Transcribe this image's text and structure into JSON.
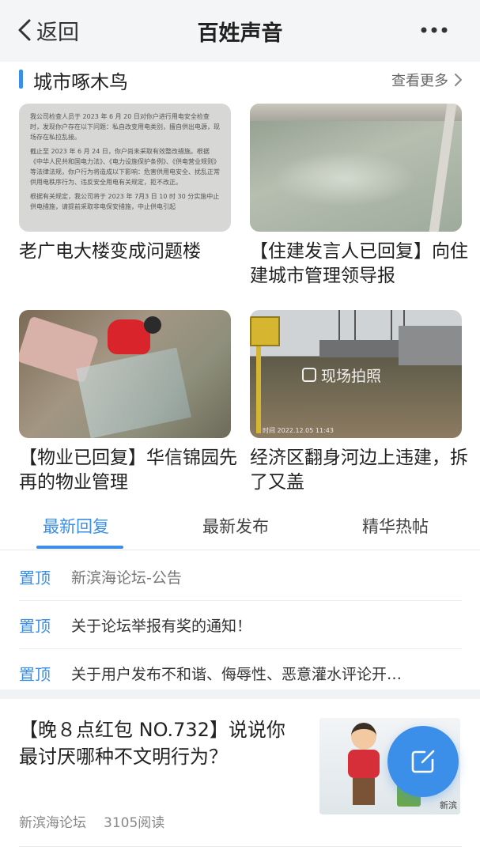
{
  "header": {
    "back_label": "返回",
    "title": "百姓声音",
    "more_icon": "more-dots-icon"
  },
  "section": {
    "title": "城市啄木鸟",
    "see_more": "查看更多"
  },
  "cards": [
    {
      "caption": "老广电大楼变成问题楼",
      "image": "notice-document",
      "notice_lines": [
        "我公司检查人员于 2023 年 6 月 20 日对你户进行用电安全检查时，发现你户存在以下问题：私自改变用电类别，擅自供出电源，现场存在私拉乱接。",
        "截止至 2023 年 6 月 24 日，你户尚未采取有效整改措施。根据《中华人民共和国电力法》、《电力设施保护条例》、《供电营业规则》等法律法规，你户行为将造成以下影响：危害供用电安全、扰乱正常供用电秩序行为、违反安全用电有关规定，拒不改正。",
        "根据有关规定，我公司将于 2023 年 7月3 日 10 时 30 分实施中止供电措施，请提前采取非电保安措施，中止供电引起"
      ]
    },
    {
      "caption": "【住建发言人已回复】向住建城市管理领导报",
      "image": "river-water"
    },
    {
      "caption": "【物业已回复】华信锦园先再的物业管理",
      "image": "person-in-bushes"
    },
    {
      "caption": "经济区翻身河边上违建，拆了又盖",
      "image": "field-construction",
      "badge": "现场拍照",
      "stamp": "时间 2022.12.05 11:43"
    }
  ],
  "tabs": [
    {
      "label": "最新回复",
      "active": true
    },
    {
      "label": "最新发布",
      "active": false
    },
    {
      "label": "精华热帖",
      "active": false
    }
  ],
  "pinned": [
    {
      "tag": "置顶",
      "text": "新滨海论坛-公告"
    },
    {
      "tag": "置顶",
      "text": "关于论坛举报有奖的通知！"
    },
    {
      "tag": "置顶",
      "text": "关于用户发布不和谐、侮辱性、恶意灌水评论开…"
    }
  ],
  "article": {
    "title": "【晚８点红包 NO.732】说说你最讨厌哪种不文明行为？",
    "source": "新滨海论坛",
    "reads": "3105阅读",
    "image_logo": "新滨"
  },
  "fab": {
    "icon": "compose-icon"
  },
  "colors": {
    "accent": "#3b8fe8",
    "topbar": "#f4f5f7"
  }
}
